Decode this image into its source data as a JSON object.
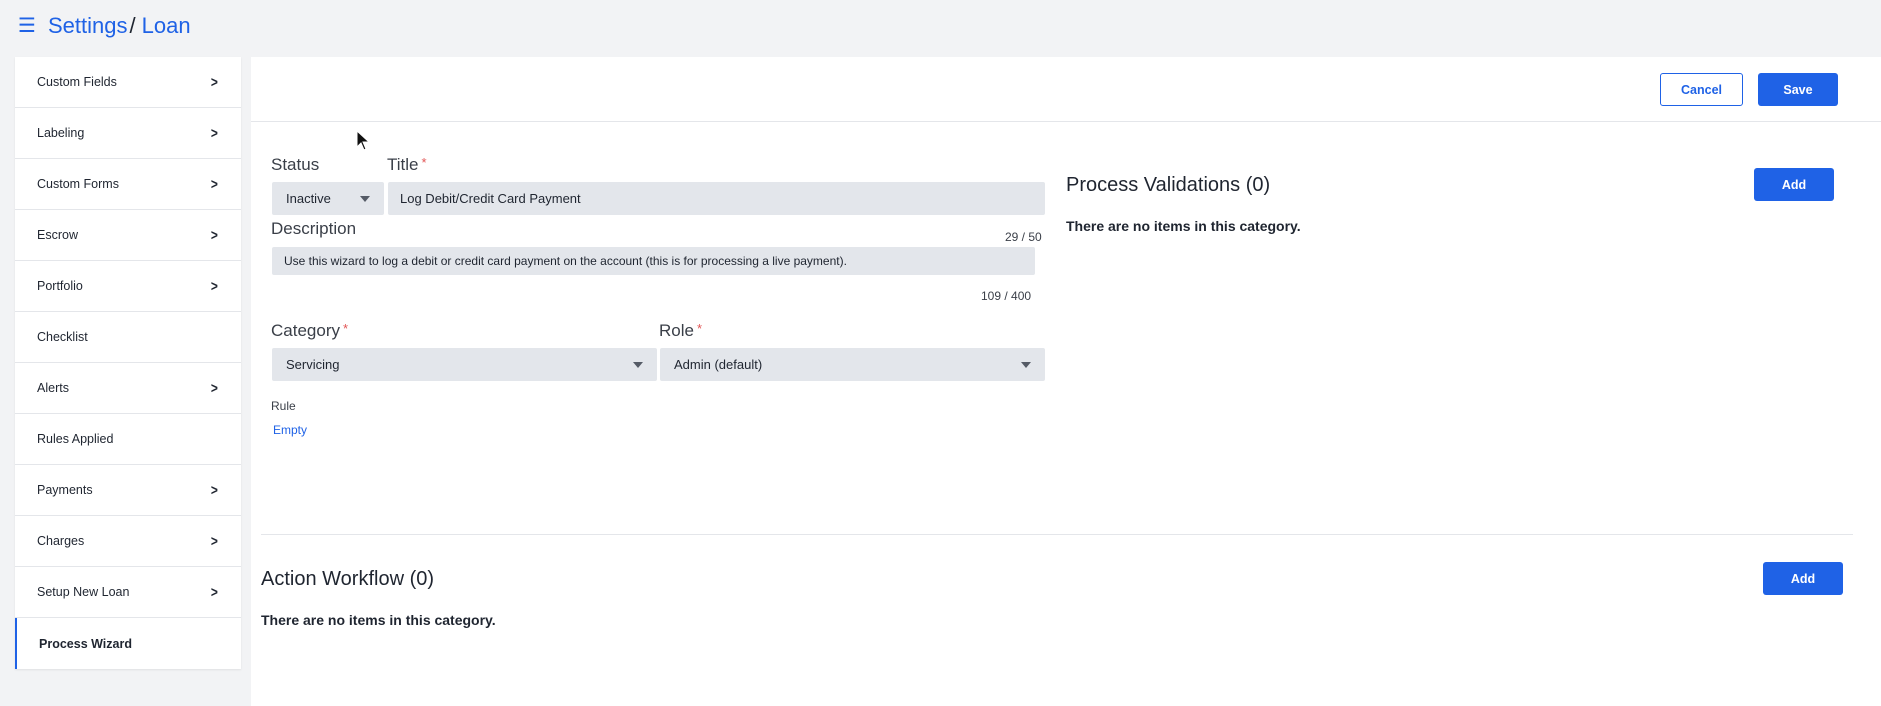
{
  "breadcrumb": {
    "menu_icon": "hamburger-menu-icon",
    "root": "Settings",
    "separator": "/",
    "current": "Loan"
  },
  "sidebar": {
    "items": [
      {
        "label": "Custom Fields",
        "has_chevron": true
      },
      {
        "label": "Labeling",
        "has_chevron": true
      },
      {
        "label": "Custom Forms",
        "has_chevron": true
      },
      {
        "label": "Escrow",
        "has_chevron": true
      },
      {
        "label": "Portfolio",
        "has_chevron": true
      },
      {
        "label": "Checklist",
        "has_chevron": false
      },
      {
        "label": "Alerts",
        "has_chevron": true
      },
      {
        "label": "Rules Applied",
        "has_chevron": false
      },
      {
        "label": "Payments",
        "has_chevron": true
      },
      {
        "label": "Charges",
        "has_chevron": true
      },
      {
        "label": "Setup New Loan",
        "has_chevron": true
      },
      {
        "label": "Process Wizard",
        "has_chevron": false,
        "active": true
      }
    ]
  },
  "header": {
    "cancel_label": "Cancel",
    "save_label": "Save"
  },
  "form": {
    "status_label": "Status",
    "status_value": "Inactive",
    "title_label": "Title",
    "required_mark": "*",
    "title_value": "Log Debit/Credit Card Payment",
    "title_counter": "29 / 50",
    "description_label": "Description",
    "description_value": "Use this wizard to log a debit or credit card payment on the account (this is for processing a live payment).",
    "description_counter": "109 / 400",
    "category_label": "Category",
    "category_value": "Servicing",
    "role_label": "Role",
    "role_value": "Admin (default)",
    "rule_label": "Rule",
    "rule_value": "Empty"
  },
  "process_validations": {
    "title": "Process Validations (0)",
    "add_label": "Add",
    "empty_text": "There are no items in this category."
  },
  "action_workflow": {
    "title": "Action Workflow (0)",
    "add_label": "Add",
    "empty_text": "There are no items in this category."
  },
  "colors": {
    "accent": "#1f62e6",
    "field_bg": "#e3e6eb",
    "page_bg": "#f2f3f5",
    "required": "#e25555"
  }
}
